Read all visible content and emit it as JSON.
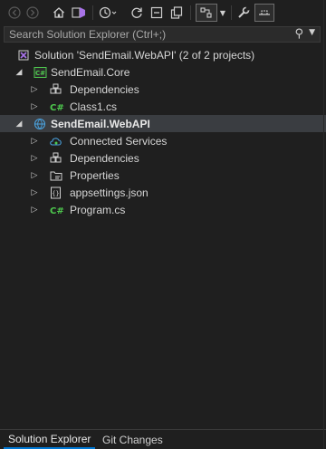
{
  "colors": {
    "background": "#1f1f1f",
    "selection": "#3a3d41",
    "csharp_green": "#4ec94e",
    "folder_blue": "#4aa3e0",
    "tab_accent": "#0078d4"
  },
  "toolbar": {
    "back": "back-arrow-icon",
    "forward": "forward-arrow-icon",
    "home": "home-icon",
    "switch_views": "switch-views-icon",
    "history": "history-icon",
    "sync": "sync-icon",
    "collapse_all": "collapse-all-icon",
    "show_all_files": "show-all-files-icon",
    "preview": "preview-selected-icon",
    "properties": "wrench-icon",
    "pin": "pin-icon"
  },
  "search": {
    "placeholder": "Search Solution Explorer (Ctrl+;)"
  },
  "tree": {
    "solution": "Solution 'SendEmail.WebAPI' (2 of 2 projects)",
    "core_project": "SendEmail.Core",
    "core_dependencies": "Dependencies",
    "core_class1": "Class1.cs",
    "webapi_project": "SendEmail.WebAPI",
    "connected_services": "Connected Services",
    "webapi_dependencies": "Dependencies",
    "properties": "Properties",
    "appsettings": "appsettings.json",
    "program": "Program.cs"
  },
  "tabs": {
    "solution_explorer": "Solution Explorer",
    "git_changes": "Git Changes"
  }
}
